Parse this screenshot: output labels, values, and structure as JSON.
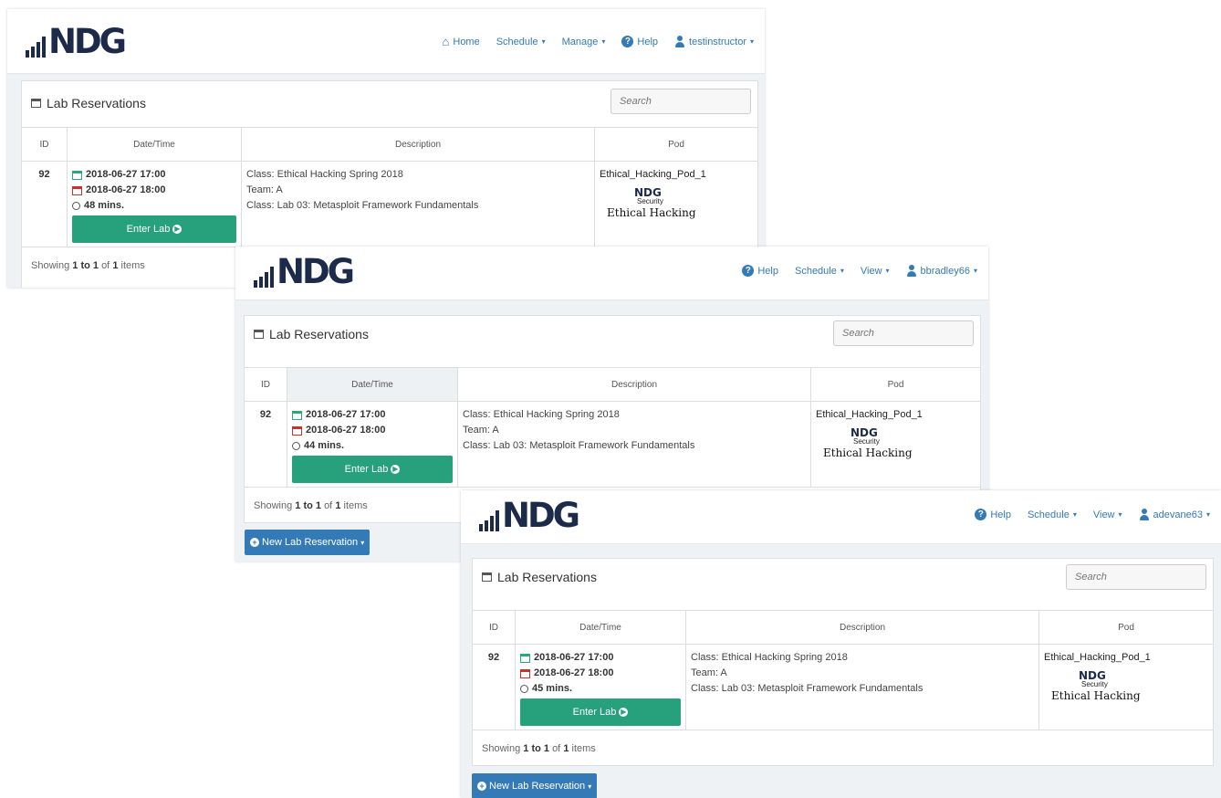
{
  "brand": {
    "logo_text": "NDG",
    "pod_logo": "NDG",
    "pod_security": "Security",
    "pod_course": "Ethical Hacking"
  },
  "colors": {
    "nav_link": "#337ab7",
    "enter_button": "#26a17b",
    "new_button": "#337ab7",
    "logo": "#1d2b4a"
  },
  "windows": [
    {
      "menu": [
        {
          "icon": "home-icon",
          "label": "Home",
          "has_caret": false
        },
        {
          "icon": "",
          "label": "Schedule",
          "has_caret": true
        },
        {
          "icon": "",
          "label": "Manage",
          "has_caret": true
        },
        {
          "icon": "help-icon",
          "label": "Help",
          "has_caret": false
        },
        {
          "icon": "user-icon",
          "label": "testinstructor",
          "has_caret": true
        }
      ],
      "panel_title": "Lab Reservations",
      "search_placeholder": "Search",
      "columns": [
        "ID",
        "Date/Time",
        "Description",
        "Pod"
      ],
      "row": {
        "id": "92",
        "start": "2018-06-27 17:00",
        "end": "2018-06-27 18:00",
        "duration": "48 mins.",
        "enter_label": "Enter Lab",
        "desc_class": "Class: Ethical Hacking Spring 2018",
        "desc_team": "Team: A",
        "desc_lab": "Class: Lab 03: Metasploit Framework Fundamentals",
        "pod": "Ethical_Hacking_Pod_1"
      },
      "footer": {
        "prefix": "Showing",
        "range": "1 to 1",
        "of": "of",
        "count": "1",
        "suffix": "items"
      }
    },
    {
      "menu": [
        {
          "icon": "help-icon",
          "label": "Help",
          "has_caret": false
        },
        {
          "icon": "",
          "label": "Schedule",
          "has_caret": true
        },
        {
          "icon": "",
          "label": "View",
          "has_caret": true
        },
        {
          "icon": "user-icon",
          "label": "bbradley66",
          "has_caret": true
        }
      ],
      "panel_title": "Lab Reservations",
      "search_placeholder": "Search",
      "columns": [
        "ID",
        "Date/Time",
        "Description",
        "Pod"
      ],
      "row": {
        "id": "92",
        "start": "2018-06-27 17:00",
        "end": "2018-06-27 18:00",
        "duration": "44 mins.",
        "enter_label": "Enter Lab",
        "desc_class": "Class: Ethical Hacking Spring 2018",
        "desc_team": "Team: A",
        "desc_lab": "Class: Lab 03: Metasploit Framework Fundamentals",
        "pod": "Ethical_Hacking_Pod_1"
      },
      "footer": {
        "prefix": "Showing",
        "range": "1 to 1",
        "of": "of",
        "count": "1",
        "suffix": "items"
      },
      "new_button": "New Lab Reservation"
    },
    {
      "menu": [
        {
          "icon": "help-icon",
          "label": "Help",
          "has_caret": false
        },
        {
          "icon": "",
          "label": "Schedule",
          "has_caret": true
        },
        {
          "icon": "",
          "label": "View",
          "has_caret": true
        },
        {
          "icon": "user-icon",
          "label": "adevane63",
          "has_caret": true
        }
      ],
      "panel_title": "Lab Reservations",
      "search_placeholder": "Search",
      "columns": [
        "ID",
        "Date/Time",
        "Description",
        "Pod"
      ],
      "row": {
        "id": "92",
        "start": "2018-06-27 17:00",
        "end": "2018-06-27 18:00",
        "duration": "45 mins.",
        "enter_label": "Enter Lab",
        "desc_class": "Class: Ethical Hacking Spring 2018",
        "desc_team": "Team: A",
        "desc_lab": "Class: Lab 03: Metasploit Framework Fundamentals",
        "pod": "Ethical_Hacking_Pod_1"
      },
      "footer": {
        "prefix": "Showing",
        "range": "1 to 1",
        "of": "of",
        "count": "1",
        "suffix": "items"
      },
      "new_button": "New Lab Reservation"
    }
  ]
}
